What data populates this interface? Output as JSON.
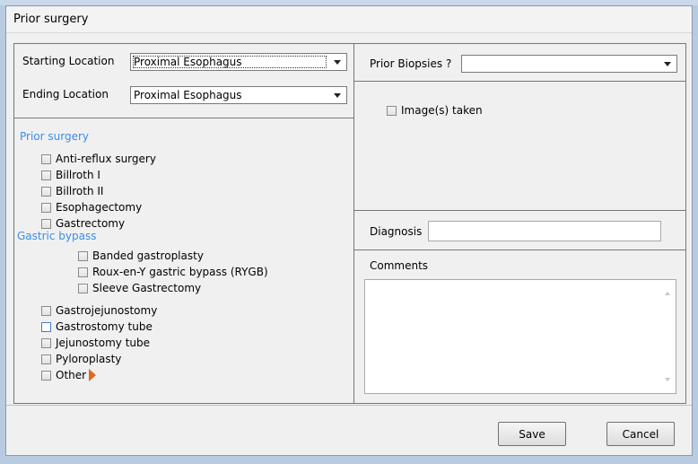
{
  "window": {
    "title": "Prior surgery"
  },
  "location": {
    "starting_label": "Starting Location",
    "starting_value": "Proximal Esophagus",
    "ending_label": "Ending Location",
    "ending_value": "Proximal Esophagus"
  },
  "prior_surgery": {
    "heading": "Prior surgery",
    "items": [
      "Anti-reflux surgery",
      "Billroth I",
      "Billroth II",
      "Esophagectomy",
      "Gastrectomy"
    ],
    "gastric_heading": "Gastric bypass",
    "gastric_items": [
      "Banded gastroplasty",
      "Roux-en-Y gastric bypass (RYGB)",
      "Sleeve Gastrectomy"
    ],
    "more_items": [
      "Gastrojejunostomy",
      "Gastrostomy tube",
      "Jejunostomy tube",
      "Pyloroplasty",
      "Other"
    ]
  },
  "biopsies": {
    "label": "Prior Biopsies ?",
    "value": ""
  },
  "images": {
    "label": "Image(s) taken",
    "checked": false
  },
  "diagnosis": {
    "label": "Diagnosis",
    "value": ""
  },
  "comments": {
    "label": "Comments",
    "value": ""
  },
  "buttons": {
    "save": "Save",
    "cancel": "Cancel"
  },
  "colors": {
    "section_heading": "#3a8ee6",
    "other_arrow": "#e06a1b"
  }
}
